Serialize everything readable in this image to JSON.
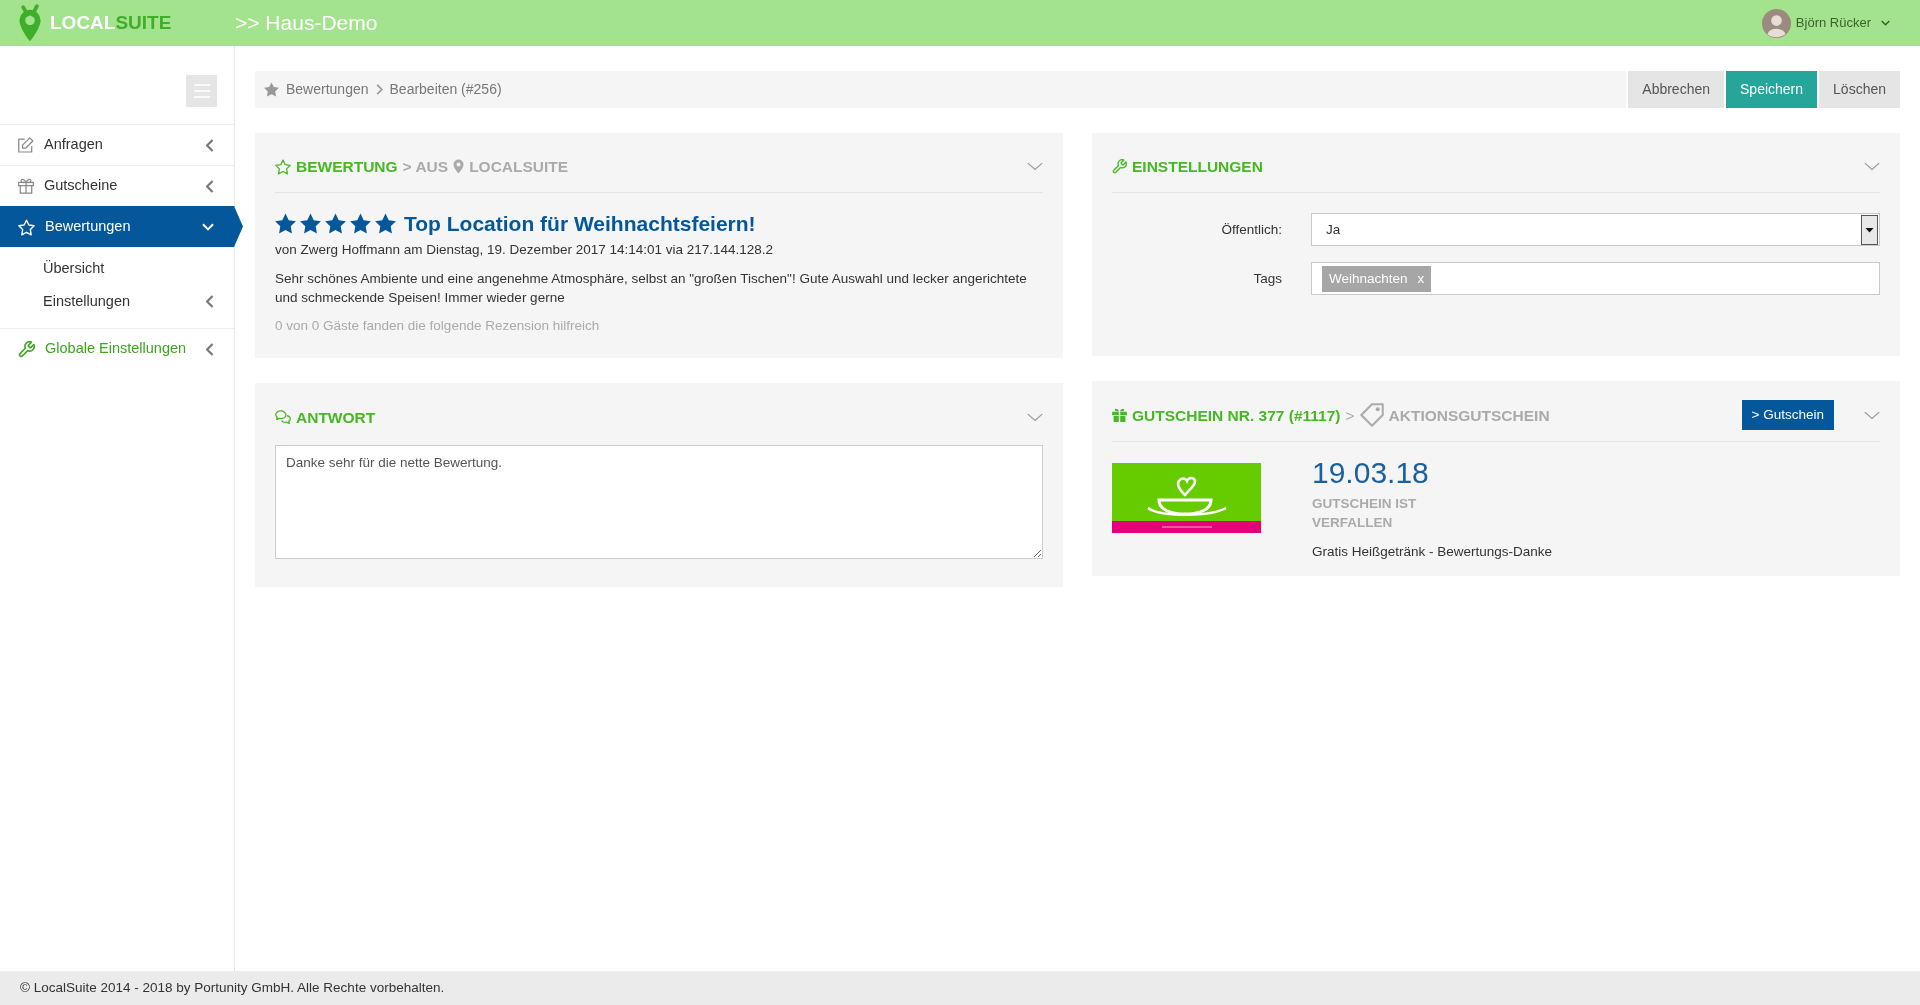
{
  "header": {
    "logo": {
      "part_1": "LOCAL",
      "part_2": "SUITE"
    },
    "title": ">> Haus-Demo",
    "user": {
      "name": "Björn Rücker"
    }
  },
  "sidebar": {
    "items": [
      {
        "label": "Anfragen",
        "kind": "module",
        "selected": false,
        "expanded": false
      },
      {
        "label": "Gutscheine",
        "kind": "module",
        "selected": false,
        "expanded": false
      },
      {
        "label": "Bewertungen",
        "kind": "module",
        "selected": true,
        "expanded": true,
        "children": [
          {
            "label": "Übersicht",
            "selected": false
          },
          {
            "label": "Einstellungen",
            "selected": false,
            "expanded": false
          }
        ]
      },
      {
        "label": "Globale Einstellungen",
        "kind": "global",
        "selected": false,
        "expanded": false
      }
    ]
  },
  "breadcrumb": [
    "Bewertungen",
    "Bearbeiten (#256)"
  ],
  "actions": [
    {
      "label": "Abbrechen",
      "kind": "default"
    },
    {
      "label": "Speichern",
      "kind": "primary"
    },
    {
      "label": "Löschen",
      "kind": "default"
    }
  ],
  "review": {
    "title": "BEWERTUNG",
    "source_prefix": "> AUS",
    "source": "LOCALSUITE",
    "stars": 5,
    "headline": "Top Location für Weihnachtsfeiern!",
    "meta": "von Zwerg Hoffmann am Dienstag, 19. Dezember 2017 14:14:01 via 217.144.128.2",
    "text": "Sehr schönes Ambiente und eine angenehme Atmosphäre, selbst an \"großen Tischen\"! Gute Auswahl und lecker angerichtete und schmeckende Speisen! Immer wieder gerne",
    "helpful": "0 von 0 Gäste fanden die folgende Rezension hilfreich"
  },
  "reply": {
    "title": "ANTWORT",
    "value": "Danke sehr für die nette Bewertung."
  },
  "settings": {
    "title": "EINSTELLUNGEN",
    "fields": [
      {
        "label": "Öffentlich:",
        "kind": "select",
        "value": "Ja"
      },
      {
        "label": "Tags",
        "kind": "tags",
        "tags": [
          {
            "label": "Weihnachten",
            "remove": "x"
          }
        ]
      }
    ]
  },
  "voucher": {
    "title": "GUTSCHEIN NR. 377 (#1117)",
    "separator": ">",
    "type": "AKTIONSGUTSCHEIN",
    "button": "> Gutschein",
    "date": "19.03.18",
    "status": "GUTSCHEIN IST VERFALLEN",
    "description": "Gratis Heißgetränk - Bewertungs-Danke"
  },
  "footer": "© LocalSuite 2014 - 2018 by Portunity GmbH. Alle Rechte vorbehalten."
}
